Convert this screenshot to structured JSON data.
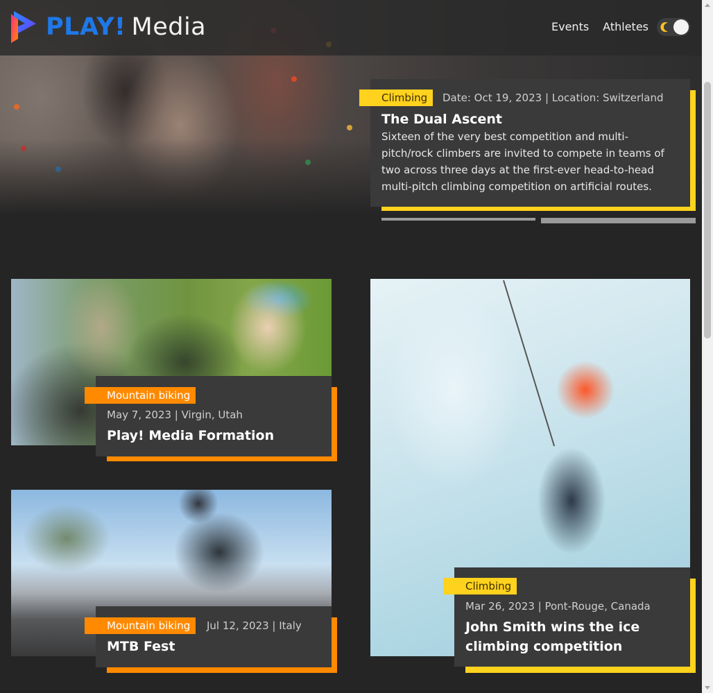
{
  "nav": {
    "brand_play": "PLAY!",
    "brand_media": "Media",
    "links": [
      "Events",
      "Athletes"
    ]
  },
  "hero": {
    "category": "Climbing",
    "meta": "Date: Oct 19, 2023 | Location: Switzerland",
    "title": "The Dual Ascent",
    "description": "Sixteen of the very best competition and multi-pitch/rock climbers are invited to compete in teams of two across three days at the first-ever head-to-head multi-pitch climbing competition on artificial routes."
  },
  "cards": [
    {
      "category": "Mountain biking",
      "meta": "May 7, 2023 | Virgin, Utah",
      "title": "Play! Media Formation"
    },
    {
      "category": "Mountain biking",
      "meta": "Jul 12, 2023 | Italy",
      "title": "MTB Fest"
    },
    {
      "category": "Climbing",
      "meta": "Mar 26, 2023 | Pont-Rouge, Canada",
      "title": "John Smith wins the ice climbing competition"
    }
  ],
  "colors": {
    "background": "#252525",
    "card": "#3a3a3a",
    "accent_yellow": "#ffd21e",
    "accent_orange": "#ff8a00",
    "brand_blue": "#1f78e8"
  },
  "icons": {
    "logo": "play-logo-icon",
    "theme_toggle": "moon-icon"
  }
}
